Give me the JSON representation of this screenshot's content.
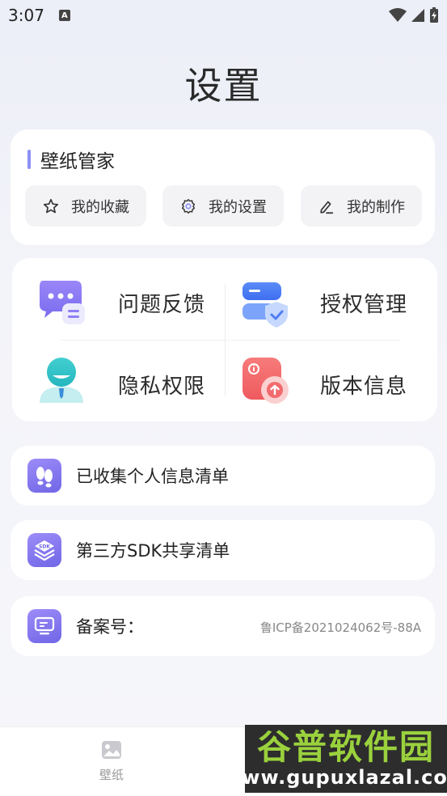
{
  "status_bar": {
    "time": "3:07",
    "notif_icon": "A"
  },
  "header": {
    "title": "设置"
  },
  "wallpaper_card": {
    "title": "壁纸管家",
    "chips": [
      {
        "label": "我的收藏",
        "icon": "star-icon"
      },
      {
        "label": "我的设置",
        "icon": "gear-icon"
      },
      {
        "label": "我的制作",
        "icon": "edit-icon"
      }
    ]
  },
  "grid": [
    {
      "label": "问题反馈",
      "icon": "feedback-icon"
    },
    {
      "label": "授权管理",
      "icon": "authorization-icon"
    },
    {
      "label": "隐私权限",
      "icon": "privacy-icon"
    },
    {
      "label": "版本信息",
      "icon": "version-info-icon"
    }
  ],
  "rows": [
    {
      "label": "已收集个人信息清单",
      "icon": "footprint-icon"
    },
    {
      "label": "第三方SDK共享清单",
      "icon": "sdk-icon"
    },
    {
      "label": "备案号：",
      "value": "鲁ICP备2021024062号-88A",
      "icon": "monitor-icon"
    }
  ],
  "bottom_nav": {
    "items": [
      {
        "label": "壁纸",
        "icon": "wallpaper-icon"
      }
    ]
  },
  "watermark": {
    "title": "谷普软件园",
    "url": "www.gupuxlazal.com"
  },
  "colors": {
    "accent": "#8d90f5",
    "icon_purple": "#7066e6"
  }
}
